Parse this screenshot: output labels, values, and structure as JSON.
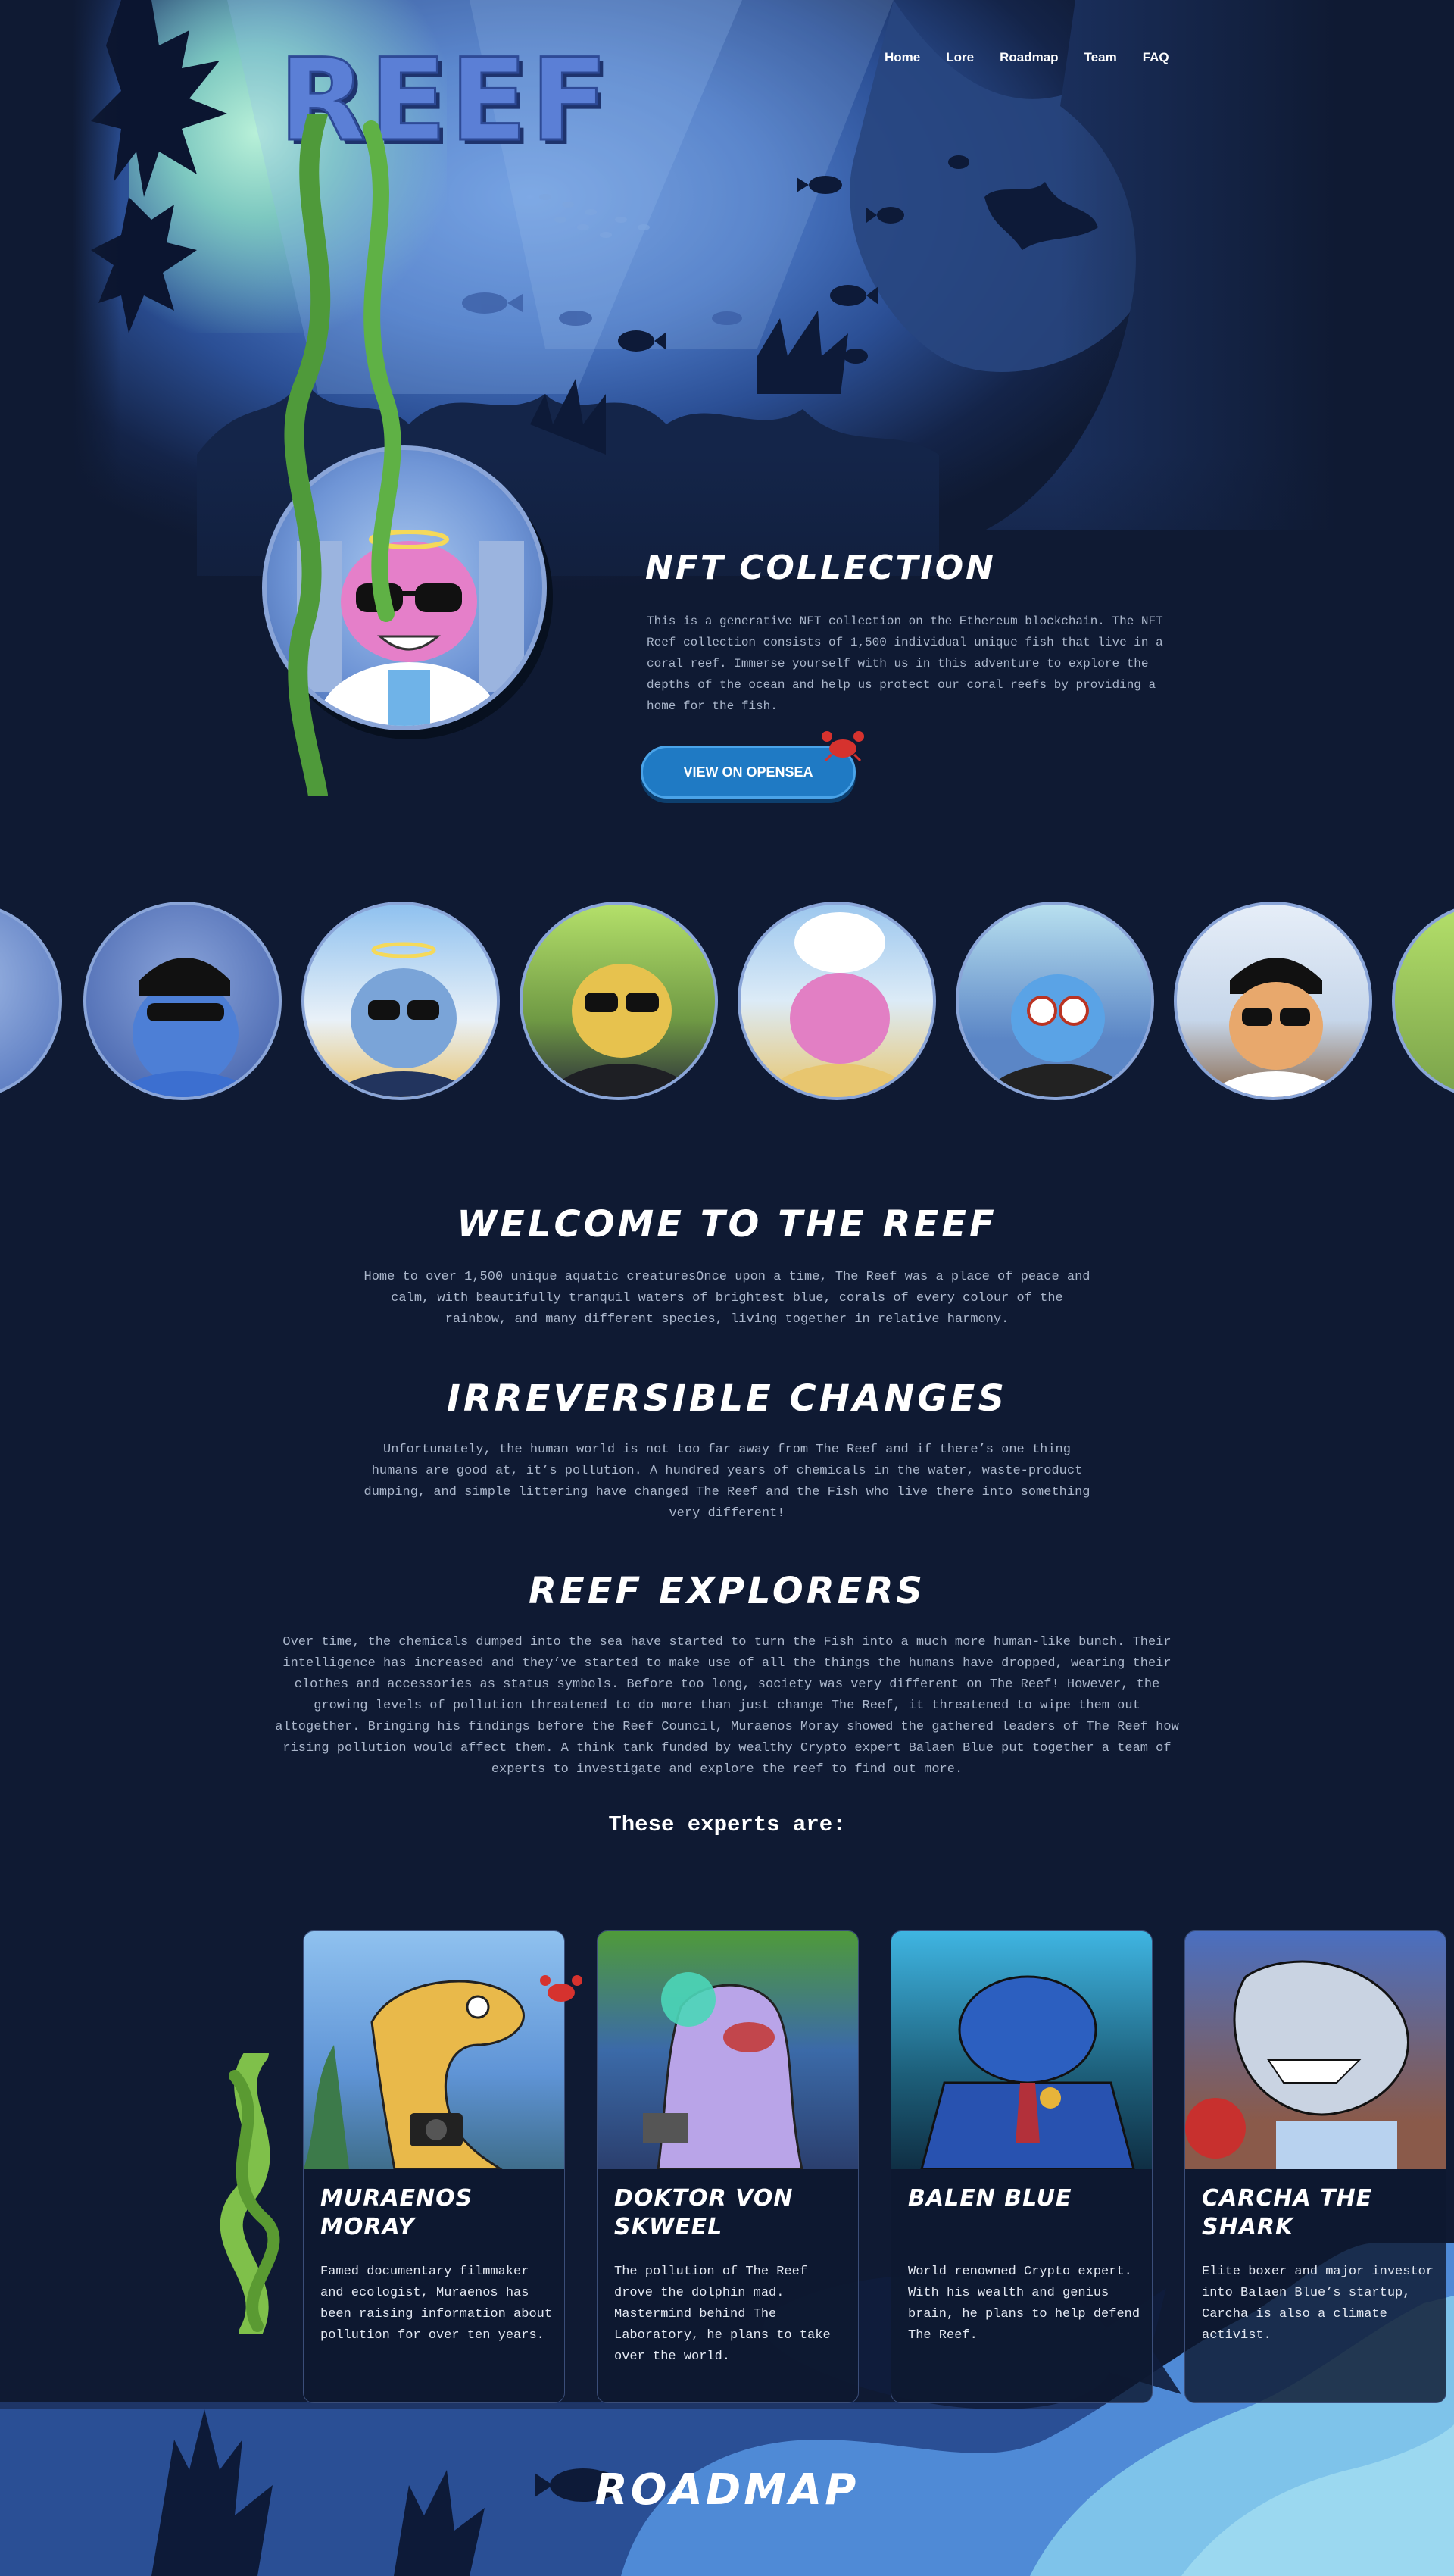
{
  "logo": {
    "text": "REEF"
  },
  "nav": {
    "items": [
      "Home",
      "Lore",
      "Roadmap",
      "Team",
      "FAQ"
    ]
  },
  "hero": {
    "title": "NFT COLLECTION",
    "description": "This is a generative NFT collection on the Ethereum blockchain. The NFT Reef collection consists of 1,500 individual unique fish that live in a coral reef. Immerse yourself with us in this adventure to explore the depths of the ocean and help us protect our coral reefs by providing a home for the fish.",
    "cta": "VIEW ON OPENSEA"
  },
  "welcome": {
    "title": "WELCOME TO THE REEF",
    "text": "Home to over 1,500 unique aquatic creaturesOnce upon a time, The Reef was a place of peace and calm, with beautifully tranquil waters of brightest blue, corals of every colour of the rainbow, and many different species, living together in relative harmony."
  },
  "changes": {
    "title": "IRREVERSIBLE CHANGES",
    "text": "Unfortunately, the human world is not too far away from The Reef and if there’s one thing humans are good at, it’s pollution. A hundred years of chemicals in the water, waste-product dumping, and simple littering have changed The Reef and the Fish who live there into something very different!"
  },
  "explorers": {
    "title": "REEF EXPLORERS",
    "text": "Over time, the chemicals dumped into the sea have started to turn the Fish into a much more human-like bunch. Their intelligence has increased and they’ve started to make use of all the things the humans have dropped, wearing their clothes and accessories as status symbols. Before too long, society was very different on The Reef! However, the growing levels of pollution threatened to do more than just change The Reef, it threatened to wipe them out altogether. Bringing his findings before the Reef Council, Muraenos Moray showed the gathered leaders of The Reef how rising pollution would affect them. A think tank funded by wealthy Crypto expert Balaen Blue put together a team of experts to investigate and explore the reef to find out more.",
    "experts_intro": "These experts are:"
  },
  "team": [
    {
      "name": "MURAENOS MORAY",
      "bio": "Famed documentary filmmaker and ecologist, Muraenos has been raising information about pollution for over ten years."
    },
    {
      "name": "DOKTOR VON SKWEEL",
      "bio": "The pollution of The Reef drove the dolphin mad. Mastermind behind The Laboratory, he plans to take over the world."
    },
    {
      "name": "BALEN BLUE",
      "bio": "World renowned Crypto expert. With his wealth and genius brain, he plans to help defend The Reef."
    },
    {
      "name": "CARCHA THE SHARK",
      "bio": "Elite boxer and major investor into Balaen Blue’s startup, Carcha is also a climate activist."
    }
  ],
  "roadmap": {
    "title": "ROADMAP"
  },
  "colors": {
    "background": "#0f1a33",
    "accent": "#1f7ac4",
    "text": "#aab6cb"
  }
}
